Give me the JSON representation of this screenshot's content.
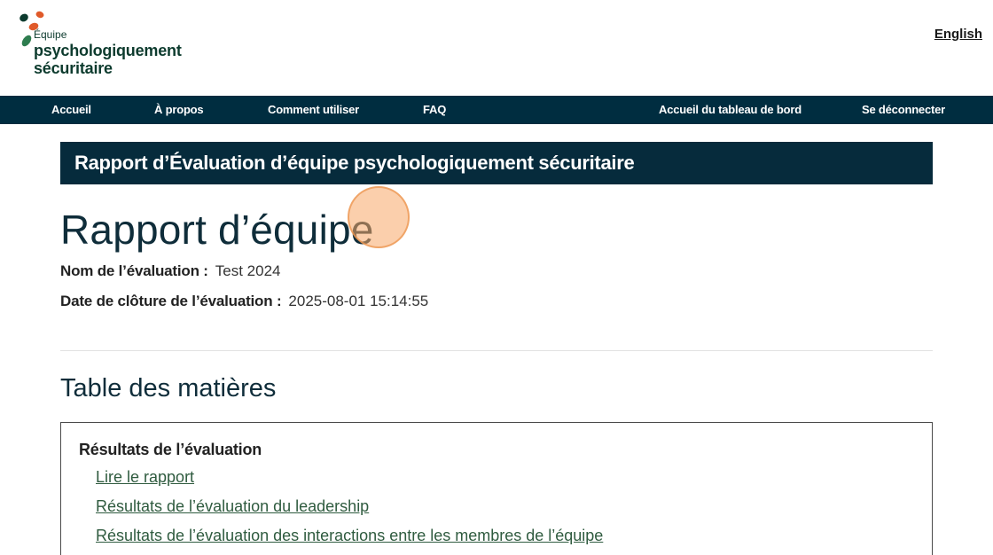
{
  "header": {
    "logo": {
      "small": "Équipe",
      "line1": "psychologiquement",
      "line2": "sécuritaire"
    },
    "language_link": "English"
  },
  "nav": {
    "items": [
      {
        "label": "Accueil"
      },
      {
        "label": "À propos"
      },
      {
        "label": "Comment utiliser"
      },
      {
        "label": "FAQ"
      },
      {
        "label": "Accueil du tableau de bord"
      },
      {
        "label": "Se déconnecter"
      }
    ]
  },
  "banner": {
    "title": "Rapport d’Évaluation d’équipe psychologiquement sécuritaire"
  },
  "page": {
    "title": "Rapport d’équipe",
    "meta": [
      {
        "label": "Nom de l’évaluation :",
        "value": "Test 2024"
      },
      {
        "label": "Date de clôture de l’évaluation :",
        "value": "2025-08-01 15:14:55"
      }
    ]
  },
  "toc": {
    "title": "Table des matières",
    "section": "Résultats de l’évaluation",
    "links": [
      {
        "label": "Lire le rapport"
      },
      {
        "label": "Résultats de l’évaluation du leadership"
      },
      {
        "label": "Résultats de l’évaluation des interactions entre les membres de l’équipe"
      }
    ]
  },
  "colors": {
    "nav_bg": "#002d40",
    "banner_bg": "#062b3c",
    "link": "#2f5b3f",
    "logo_orange": "#e05a2a",
    "logo_green": "#2e7d4f",
    "logo_dark": "#0d3b2e",
    "cursor": "#f7a868"
  }
}
